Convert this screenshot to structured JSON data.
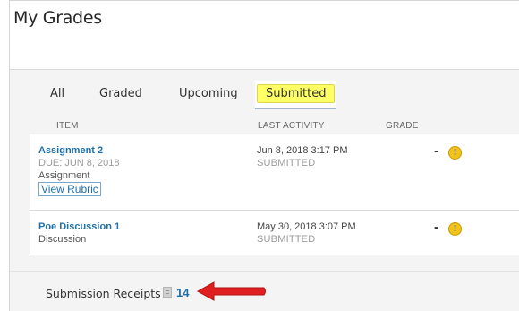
{
  "page": {
    "title": "My Grades"
  },
  "tabs": [
    {
      "label": "All",
      "active": false
    },
    {
      "label": "Graded",
      "active": false
    },
    {
      "label": "Upcoming",
      "active": false
    },
    {
      "label": "Submitted",
      "active": true
    }
  ],
  "columns": {
    "item": "ITEM",
    "last_activity": "LAST ACTIVITY",
    "grade": "GRADE"
  },
  "rows": [
    {
      "title": "Assignment 2",
      "due": "DUE: JUN 8, 2018",
      "type": "Assignment",
      "link": "View Rubric",
      "activity_date": "Jun 8, 2018 3:17 PM",
      "status": "SUBMITTED",
      "grade": "-",
      "grade_icon": "warning-icon"
    },
    {
      "title": "Poe Discussion 1",
      "type": "Discussion",
      "activity_date": "May 30, 2018 3:07 PM",
      "status": "SUBMITTED",
      "grade": "-",
      "grade_icon": "warning-icon"
    }
  ],
  "receipts": {
    "label": "Submission Receipts",
    "count": "14",
    "icon": "receipt-icon"
  },
  "annotation": {
    "icon": "red-arrow-icon",
    "color": "#e02020"
  },
  "colors": {
    "link": "#1f6fa8",
    "highlight": "#ffff66",
    "warning": "#f2c31b"
  }
}
